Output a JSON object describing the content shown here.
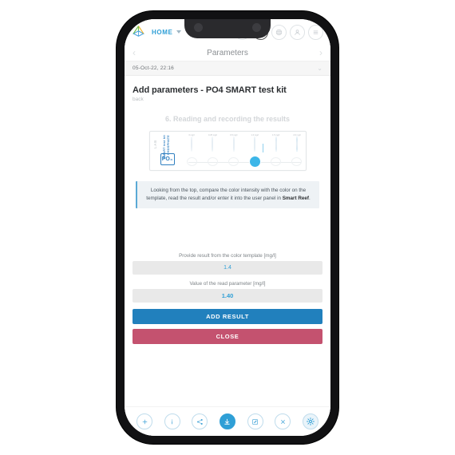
{
  "app": {
    "home_label": "HOME",
    "logo_icon": "cube-logo-icon"
  },
  "header_icons": [
    {
      "name": "chat-icon",
      "label": "chat"
    },
    {
      "name": "expand-icon",
      "label": "expand"
    },
    {
      "name": "globe-icon",
      "label": "globe"
    },
    {
      "name": "user-icon",
      "label": "user"
    },
    {
      "name": "menu-icon",
      "label": "menu"
    }
  ],
  "navbar": {
    "title": "Parameters",
    "prev": "‹",
    "next": "›"
  },
  "datebar": {
    "date": "05-Oct-22, 22:16",
    "chevron": "⌄"
  },
  "main": {
    "page_title": "Add parameters - PO4 SMART test kit",
    "back_label": "back",
    "section_title": "6. Reading and recording the results"
  },
  "test_card": {
    "lab_text": "LAB",
    "smart_text": "SMART test kit",
    "phosphate_text": "PHOSPHATE",
    "badge": "PO₄",
    "swatches": [
      {
        "label": "0 mg/l",
        "color": "#ffffff"
      },
      {
        "label": "0.25 mg/l",
        "color": "#eaf6fc"
      },
      {
        "label": "0.5 mg/l",
        "color": "#ddf1fb"
      },
      {
        "label": "1.0 mg/l",
        "color": "#cbe9f9"
      },
      {
        "label": "1.5 mg/l",
        "color": "#9bd8f3"
      },
      {
        "label": "2.0 mg/l",
        "color": "#6cc8ec"
      }
    ],
    "active_index": 3
  },
  "info_box": {
    "text_part1": "Looking from the top, compare the color intensity with the color on the template, read the result and/or enter it into the user panel in ",
    "brand": "Smart Reef",
    "text_part2": "."
  },
  "form": {
    "field1": {
      "label": "Provide result from the color template [mg/l]",
      "value": "1.4"
    },
    "field2": {
      "label": "Value of the read parameter  [mg/l]",
      "value": "1.40"
    },
    "add_button": "ADD RESULT",
    "close_button": "CLOSE"
  },
  "toolbar": [
    {
      "name": "add-icon",
      "label": "add"
    },
    {
      "name": "info-icon",
      "label": "info"
    },
    {
      "name": "share-icon",
      "label": "share"
    },
    {
      "name": "download-icon",
      "label": "download"
    },
    {
      "name": "edit-icon",
      "label": "edit"
    },
    {
      "name": "close-icon",
      "label": "close"
    },
    {
      "name": "gear-icon",
      "label": "settings"
    }
  ],
  "colors": {
    "accent_blue": "#2180bd",
    "danger_pink": "#c4526f",
    "link_blue": "#2f9fd6",
    "swatch_active": "#3db6e8"
  }
}
